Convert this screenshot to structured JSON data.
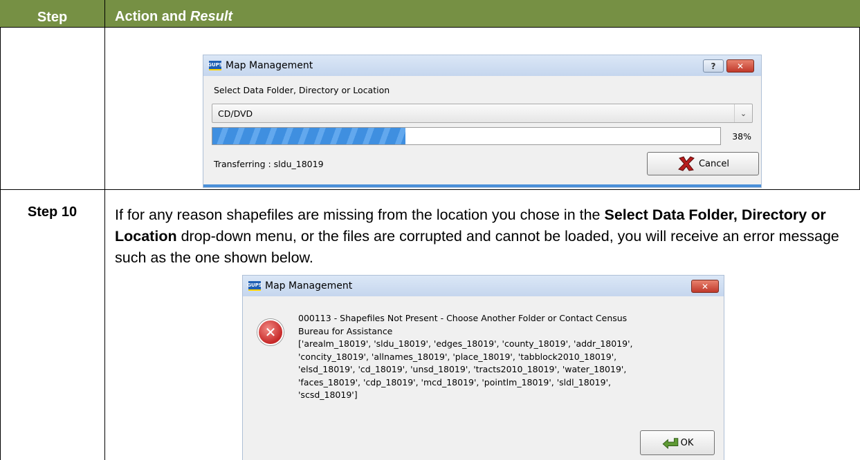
{
  "table": {
    "header_step": "Step",
    "header_action_prefix": "Action and ",
    "header_action_italic": "Result"
  },
  "dialog1": {
    "icon_text": "GUPS",
    "title": "Map Management",
    "help_glyph": "?",
    "close_glyph": "✕",
    "select_label": "Select Data Folder, Directory or Location",
    "combo_value": "CD/DVD",
    "progress_percent": 38,
    "progress_text": "38%",
    "status_text": "Transferring : sldu_18019",
    "cancel_label": "Cancel",
    "cancel_underline": "a"
  },
  "step10": {
    "label": "Step 10",
    "text_1": "If for any reason shapefiles are missing from the location you chose in the ",
    "bold_1": "Select Data Folder, Directory or Location",
    "text_2": " drop-down menu, or the files are corrupted and cannot be loaded, you will receive an error message such as the one shown below."
  },
  "dialog2": {
    "icon_text": "GUPS",
    "title": "Map Management",
    "close_glyph": "✕",
    "error_glyph": "✕",
    "message_line1": "000113 - Shapefiles Not Present - Choose Another Folder or Contact Census",
    "message_line2": "Bureau for Assistance",
    "message_line3": "['arealm_18019', 'sldu_18019', 'edges_18019', 'county_18019', 'addr_18019',",
    "message_line4": "'concity_18019', 'allnames_18019', 'place_18019', 'tabblock2010_18019',",
    "message_line5": "'elsd_18019', 'cd_18019', 'unsd_18019', 'tracts2010_18019', 'water_18019',",
    "message_line6": "'faces_18019', 'cdp_18019', 'mcd_18019', 'pointlm_18019', 'sldl_18019',",
    "message_line7": "'scsd_18019']",
    "ok_label": "OK"
  }
}
